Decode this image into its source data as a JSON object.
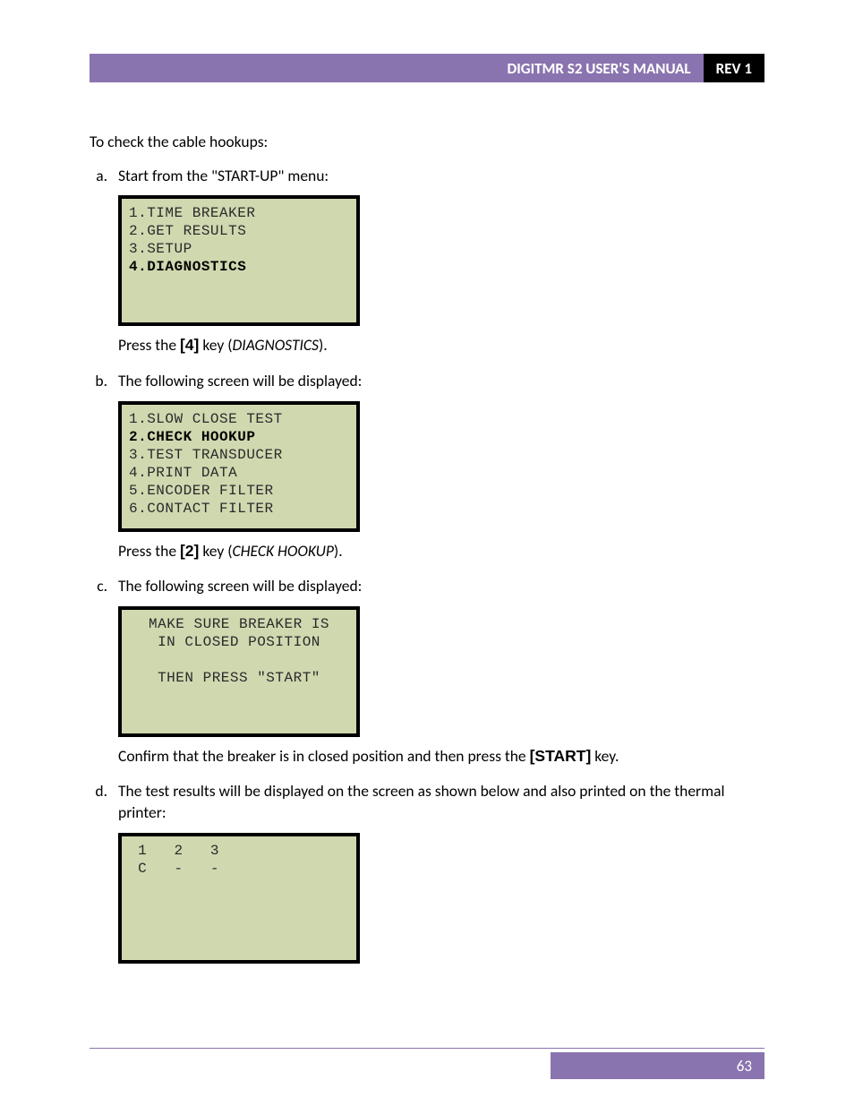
{
  "header": {
    "title": "DIGITMR S2 USER'S MANUAL",
    "rev": "REV 1"
  },
  "intro": "To check the cable hookups:",
  "steps": {
    "a": {
      "text": "Start from the \"START-UP\" menu:",
      "lcd": [
        {
          "t": "1.TIME BREAKER",
          "b": false
        },
        {
          "t": "2.GET RESULTS",
          "b": false
        },
        {
          "t": "3.SETUP",
          "b": false
        },
        {
          "t": "4.DIAGNOSTICS",
          "b": true
        }
      ],
      "after_pre": "Press the ",
      "after_key": "[4]",
      "after_mid": " key (",
      "after_italic": "DIAGNOSTICS",
      "after_post": ")."
    },
    "b": {
      "text": "The following screen will be displayed:",
      "lcd": [
        {
          "t": "1.SLOW CLOSE TEST",
          "b": false
        },
        {
          "t": "2.CHECK HOOKUP",
          "b": true
        },
        {
          "t": "3.TEST TRANSDUCER",
          "b": false
        },
        {
          "t": "4.PRINT DATA",
          "b": false
        },
        {
          "t": "5.ENCODER FILTER",
          "b": false
        },
        {
          "t": "6.CONTACT FILTER",
          "b": false
        }
      ],
      "after_pre": "Press the ",
      "after_key": "[2]",
      "after_mid": " key (",
      "after_italic": "CHECK HOOKUP",
      "after_post": ")."
    },
    "c": {
      "text": "The following screen will be displayed:",
      "lcd": [
        {
          "t": "MAKE SURE BREAKER IS",
          "b": false
        },
        {
          "t": "IN CLOSED POSITION",
          "b": false
        },
        {
          "t": "",
          "b": false
        },
        {
          "t": "THEN PRESS \"START\"",
          "b": false
        }
      ],
      "after_pre": "Confirm that the breaker is in closed position and then press the ",
      "after_key": "[START]",
      "after_post": " key."
    },
    "d": {
      "text": "The test results will be displayed on the screen as shown below and also printed on the thermal printer:",
      "lcd": [
        {
          "t": " 1   2   3",
          "b": false
        },
        {
          "t": " C   -   -",
          "b": false
        }
      ]
    }
  },
  "page_number": "63"
}
